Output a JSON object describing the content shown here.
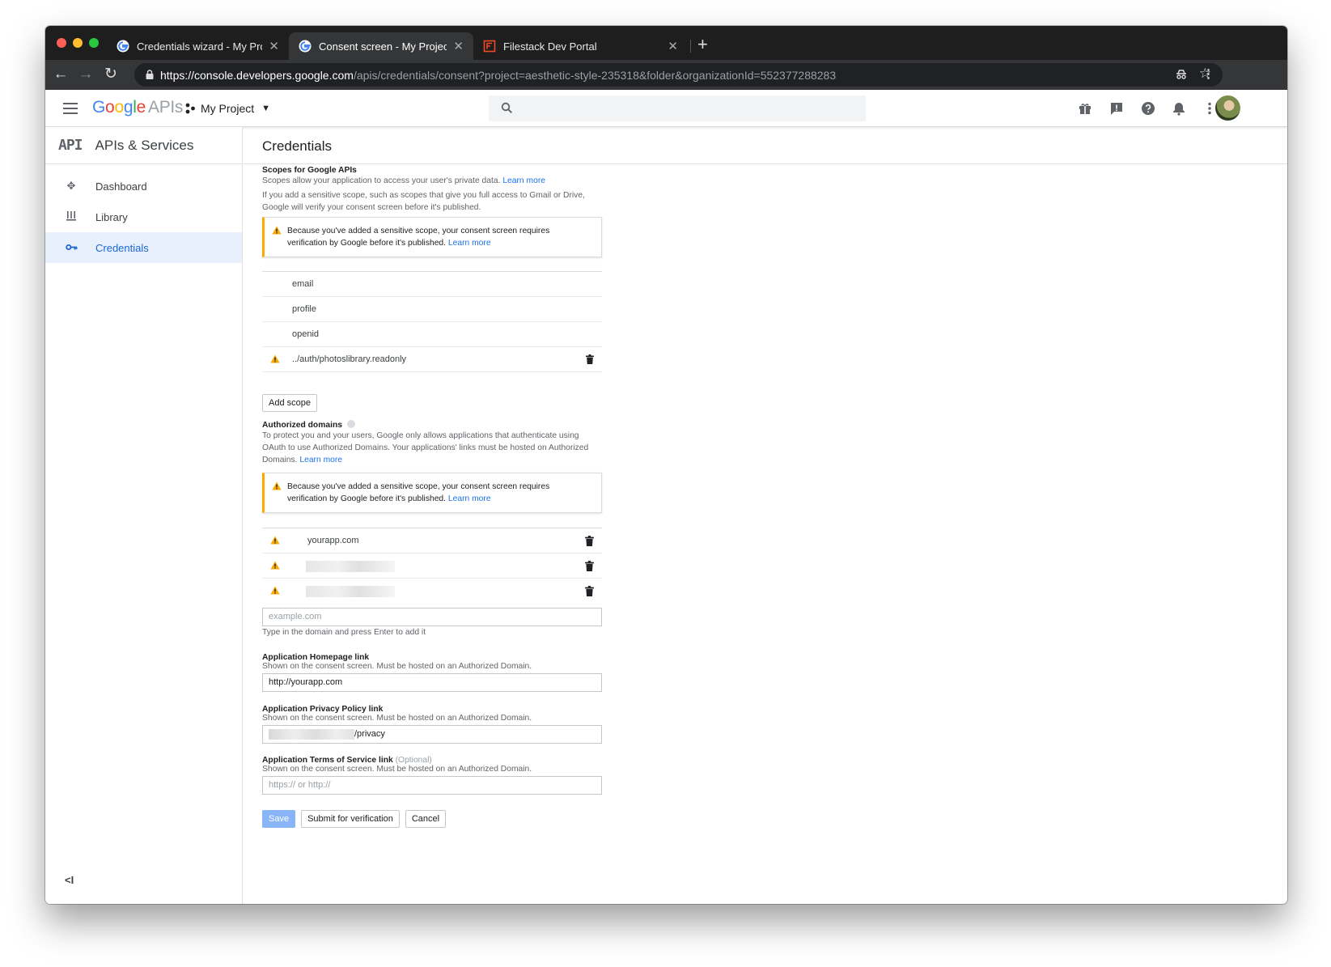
{
  "browser": {
    "tabs": [
      {
        "title": "Credentials wizard - My Projec",
        "active": false
      },
      {
        "title": "Consent screen - My Project -",
        "active": true
      },
      {
        "title": "Filestack Dev Portal",
        "active": false
      }
    ],
    "url_host": "https://console.developers.google.com",
    "url_path": "/apis/credentials/consent?project=aesthetic-style-235318&folder&organizationId=552377288283"
  },
  "header": {
    "logo_google": "Google",
    "logo_apis": "APIs",
    "project_name": "My Project"
  },
  "sidebar": {
    "title": "APIs & Services",
    "items": [
      {
        "label": "Dashboard",
        "icon": "dashboard-icon",
        "active": false
      },
      {
        "label": "Library",
        "icon": "library-icon",
        "active": false
      },
      {
        "label": "Credentials",
        "icon": "key-icon",
        "active": true
      }
    ]
  },
  "page": {
    "title": "Credentials"
  },
  "scopes": {
    "heading": "Scopes for Google APIs",
    "desc": "Scopes allow your application to access your user's private data.",
    "learn_more": "Learn more",
    "note_line1": "If you add a sensitive scope, such as scopes that give you full access to Gmail or Drive,",
    "note_line2": "Google will verify your consent screen before it's published.",
    "warning_line1": "Because you've added a sensitive scope, your consent screen requires",
    "warning_line2": "verification by Google before it's published.",
    "warning_link": "Learn more",
    "items": [
      "email",
      "profile",
      "openid",
      "../auth/photoslibrary.readonly"
    ],
    "add_button": "Add scope"
  },
  "domains": {
    "heading": "Authorized domains",
    "desc_line1": "To protect you and your users, Google only allows applications that authenticate using",
    "desc_line2": "OAuth to use Authorized Domains. Your applications' links must be hosted on Authorized",
    "desc_line3": "Domains.",
    "learn_more": "Learn more",
    "warning_line1": "Because you've added a sensitive scope, your consent screen requires",
    "warning_line2": "verification by Google before it's published.",
    "warning_link": "Learn more",
    "items": [
      "yourapp.com"
    ],
    "input_placeholder": "example.com",
    "input_hint": "Type in the domain and press Enter to add it"
  },
  "homepage": {
    "label": "Application Homepage link",
    "desc": "Shown on the consent screen. Must be hosted on an Authorized Domain.",
    "value": "http://yourapp.com"
  },
  "privacy": {
    "label": "Application Privacy Policy link",
    "desc": "Shown on the consent screen. Must be hosted on an Authorized Domain.",
    "value_suffix": "/privacy"
  },
  "tos": {
    "label": "Application Terms of Service link",
    "optional": "(Optional)",
    "desc": "Shown on the consent screen. Must be hosted on an Authorized Domain.",
    "placeholder": "https:// or http://"
  },
  "actions": {
    "save": "Save",
    "submit": "Submit for verification",
    "cancel": "Cancel"
  },
  "colors": {
    "accent": "#1a73e8",
    "warning": "#f9ab00",
    "active_nav_bg": "#e8f0fe"
  }
}
